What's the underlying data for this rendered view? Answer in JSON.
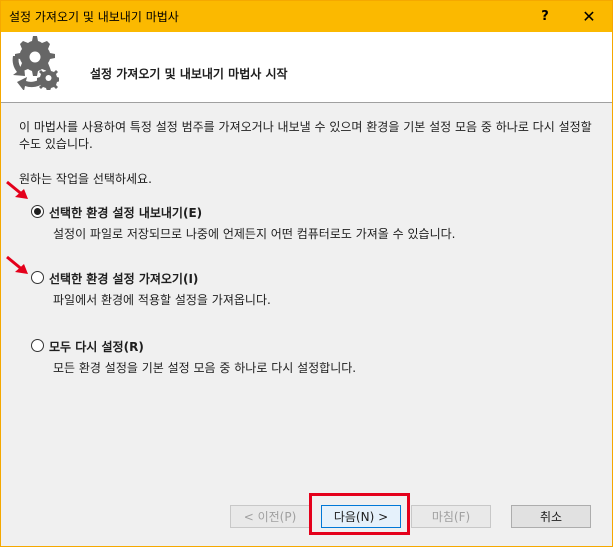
{
  "window": {
    "title": "설정 가져오기 및 내보내기 마법사",
    "help_label": "?",
    "close_label": "✕"
  },
  "header": {
    "title": "설정 가져오기 및 내보내기 마법사 시작",
    "icon": "gear-arrows-icon"
  },
  "body": {
    "description": "이 마법사를 사용하여 특정 설정 범주를 가져오거나 내보낼 수 있으며 환경을 기본 설정 모음 중 하나로 다시 설정할 수도 있습니다.",
    "prompt": "원하는 작업을 선택하세요."
  },
  "options": [
    {
      "label": "선택한 환경 설정 내보내기(E)",
      "description": "설정이 파일로 저장되므로 나중에 언제든지 어떤 컴퓨터로도 가져올 수 있습니다.",
      "selected": true
    },
    {
      "label": "선택한 환경 설정 가져오기(I)",
      "description": "파일에서 환경에 적용할 설정을 가져옵니다.",
      "selected": false
    },
    {
      "label": "모두 다시 설정(R)",
      "description": "모든 환경 설정을 기본 설정 모음 중 하나로 다시 설정합니다.",
      "selected": false
    }
  ],
  "buttons": {
    "prev": "< 이전(P)",
    "next": "다음(N) >",
    "finish": "마침(F)",
    "cancel": "취소"
  },
  "colors": {
    "titlebar": "#fbb900",
    "annotation_red": "#e4001b"
  }
}
